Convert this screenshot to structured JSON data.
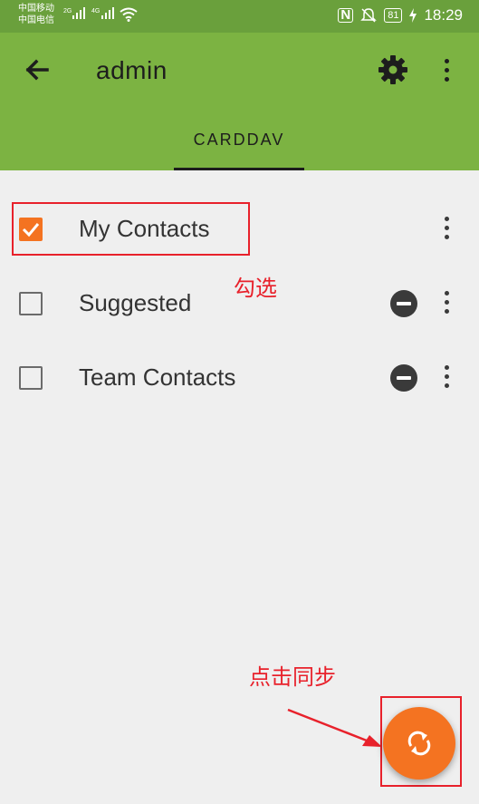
{
  "status_bar": {
    "carrier_1": "中国移动",
    "carrier_2": "中国电信",
    "net_1": "2G",
    "net_2": "4G",
    "battery": "81",
    "time": "18:29",
    "icons": [
      "signal-icon",
      "wifi-icon",
      "nfc-icon",
      "mute-icon",
      "battery-icon",
      "charging-icon"
    ]
  },
  "app_bar": {
    "title": "admin",
    "tab": "CARDDAV",
    "icons": [
      "back-arrow-icon",
      "settings-icon",
      "more-vert-icon"
    ],
    "color": "#7cb342"
  },
  "address_books": [
    {
      "label": "My Contacts",
      "checked": true
    },
    {
      "label": "Suggested",
      "checked": false
    },
    {
      "label": "Team Contacts",
      "checked": false
    }
  ],
  "annotations": {
    "check_hint": "勾选",
    "sync_hint": "点击同步",
    "color": "#e8212b"
  },
  "fab": {
    "icon": "sync-icon",
    "color": "#f47321"
  }
}
